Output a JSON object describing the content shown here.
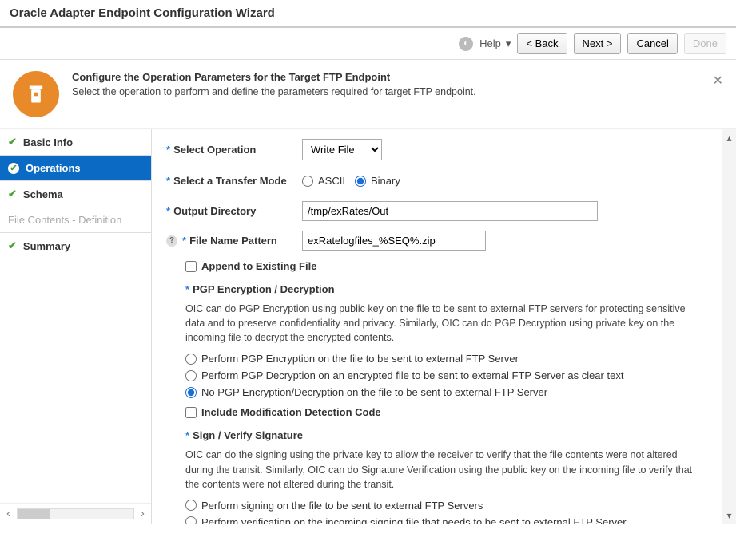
{
  "title": "Oracle Adapter Endpoint Configuration Wizard",
  "topbar": {
    "help": "Help",
    "back": "< Back",
    "next": "Next >",
    "cancel": "Cancel",
    "done": "Done"
  },
  "header": {
    "title": "Configure the Operation Parameters for the Target FTP Endpoint",
    "subtitle": "Select the operation to perform and define the parameters required for target FTP endpoint."
  },
  "steps": {
    "basic": "Basic Info",
    "operations": "Operations",
    "schema": "Schema",
    "filecontents": "File Contents - Definition",
    "summary": "Summary"
  },
  "form": {
    "select_op_label": "Select Operation",
    "select_op_value": "Write File",
    "transfer_mode_label": "Select a Transfer Mode",
    "ascii": "ASCII",
    "binary": "Binary",
    "output_dir_label": "Output Directory",
    "output_dir_value": "/tmp/exRates/Out",
    "fnp_label": "File Name Pattern",
    "fnp_value": "exRatelogfiles_%SEQ%.zip",
    "append_label": "Append to Existing File",
    "pgp_hdr": "PGP Encryption / Decryption",
    "pgp_desc": "OIC can do PGP Encryption using public key on the file to be sent to external FTP servers for protecting sensitive data and to preserve confidentiality and privacy. Similarly, OIC can do PGP Decryption using private key on the incoming file to decrypt the encrypted contents.",
    "pgp_opt1": "Perform PGP Encryption on the file to be sent to external FTP Server",
    "pgp_opt2": "Perform PGP Decryption on an encrypted file to be sent to external FTP Server as clear text",
    "pgp_opt3": "No PGP Encryption/Decryption on the file to be sent to external FTP Server",
    "mdc_label": "Include Modification Detection Code",
    "sign_hdr": "Sign / Verify Signature",
    "sign_desc": "OIC can do the signing using the private key to allow  the receiver to verify that the file contents were not altered during the transit. Similarly, OIC can do Signature Verification using the public key on the incoming file to verify that the contents were not altered during the transit.",
    "sign_opt1": "Perform signing on the file to be sent to external FTP Servers",
    "sign_opt2": "Perform verification on the incoming signing file that needs to be sent to external FTP Server"
  }
}
